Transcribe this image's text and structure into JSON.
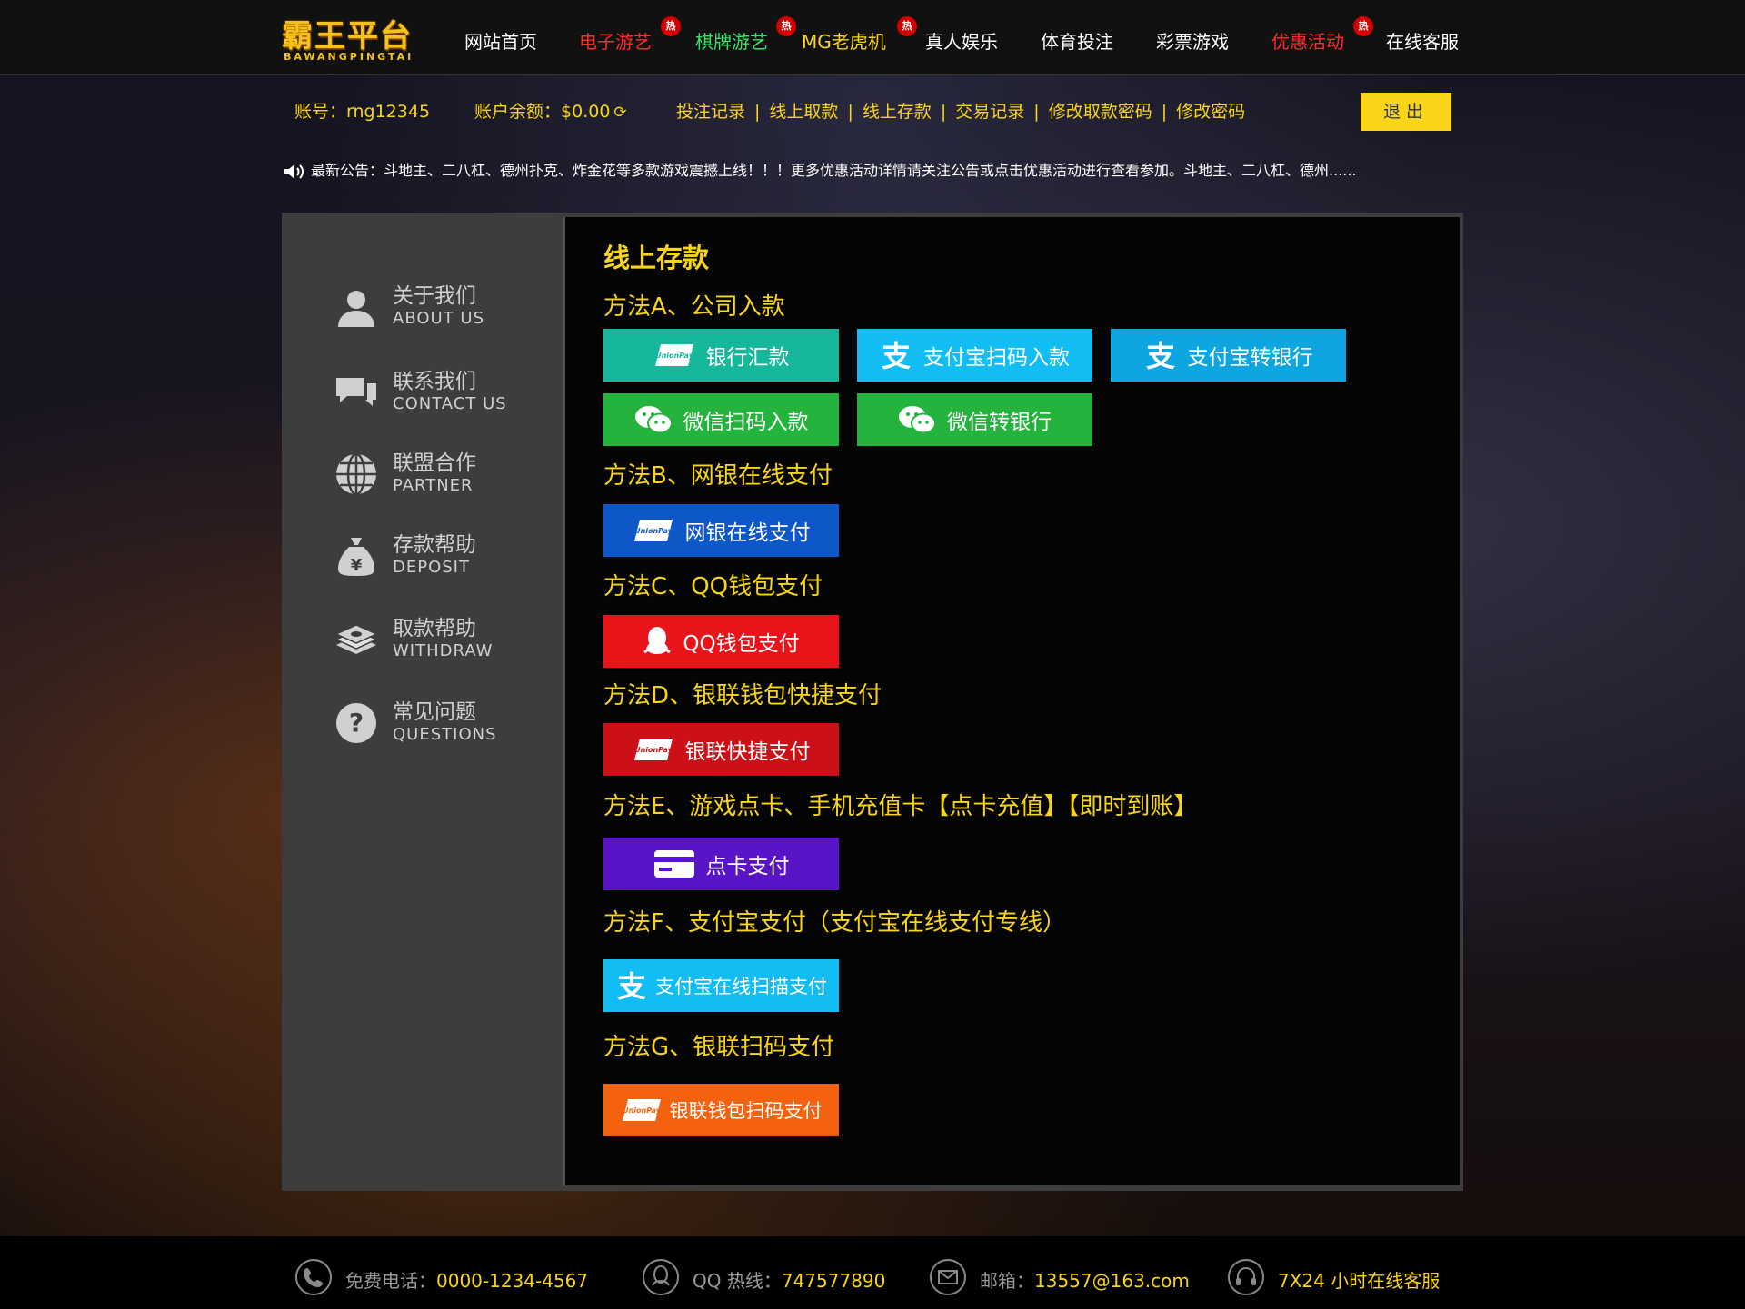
{
  "header": {
    "logo": {
      "main": "霸王平台",
      "sub": "BAWANGPINGTAI"
    },
    "nav": [
      {
        "label": "网站首页",
        "color": "white",
        "hot": false
      },
      {
        "label": "电子游艺",
        "color": "red",
        "hot": true
      },
      {
        "label": "棋牌游艺",
        "color": "green",
        "hot": true
      },
      {
        "label": "MG老虎机",
        "color": "yellow",
        "hot": true
      },
      {
        "label": "真人娱乐",
        "color": "white",
        "hot": false
      },
      {
        "label": "体育投注",
        "color": "white",
        "hot": false
      },
      {
        "label": "彩票游戏",
        "color": "white",
        "hot": false
      },
      {
        "label": "优惠活动",
        "color": "red",
        "hot": true
      },
      {
        "label": "在线客服",
        "color": "white",
        "hot": false
      }
    ],
    "hot_badge": "热"
  },
  "account": {
    "account_label": "账号：",
    "account_value": "rng12345",
    "balance_label": "账户余额：",
    "balance_value": "$0.00",
    "links": [
      "投注记录",
      "线上取款",
      "线上存款",
      "交易记录",
      "修改取款密码",
      "修改密码"
    ],
    "separator": "|",
    "logout": "退出"
  },
  "notice": "最新公告：斗地主、二八杠、德州扑克、炸金花等多款游戏震撼上线！！！更多优惠活动详情请关注公告或点击优惠活动进行查看参加。斗地主、二八杠、德州......",
  "sidebar": [
    {
      "cn": "关于我们",
      "en": "ABOUT US",
      "icon": "user-icon"
    },
    {
      "cn": "联系我们",
      "en": "CONTACT US",
      "icon": "chat-icon"
    },
    {
      "cn": "联盟合作",
      "en": "PARTNER",
      "icon": "globe-icon"
    },
    {
      "cn": "存款帮助",
      "en": "DEPOSIT",
      "icon": "money-bag-icon"
    },
    {
      "cn": "取款帮助",
      "en": "WITHDRAW",
      "icon": "cash-stack-icon"
    },
    {
      "cn": "常见问题",
      "en": "QUESTIONS",
      "icon": "question-icon"
    }
  ],
  "content": {
    "title": "线上存款",
    "methods": [
      {
        "label": "方法A、公司入款",
        "buttons": [
          {
            "label": "银行汇款",
            "color": "#17b79c",
            "icon": "unionpay-icon"
          },
          {
            "label": "支付宝扫码入款",
            "color": "#12bdf4",
            "icon": "alipay-icon"
          },
          {
            "label": "支付宝转银行",
            "color": "#0ea6e0",
            "icon": "alipay-icon"
          },
          {
            "label": "微信扫码入款",
            "color": "#24b33d",
            "icon": "wechat-icon"
          },
          {
            "label": "微信转银行",
            "color": "#24b33d",
            "icon": "wechat-icon"
          }
        ]
      },
      {
        "label": "方法B、网银在线支付",
        "buttons": [
          {
            "label": "网银在线支付",
            "color": "#0d57c9",
            "icon": "unionpay-icon"
          }
        ]
      },
      {
        "label": "方法C、QQ钱包支付",
        "buttons": [
          {
            "label": "QQ钱包支付",
            "color": "#e8141a",
            "icon": "qq-icon"
          }
        ]
      },
      {
        "label": "方法D、银联钱包快捷支付",
        "buttons": [
          {
            "label": "银联快捷支付",
            "color": "#cc1017",
            "icon": "unionpay-icon"
          }
        ]
      },
      {
        "label": "方法E、游戏点卡、手机充值卡【点卡充值】【即时到账】",
        "buttons": [
          {
            "label": "点卡支付",
            "color": "#5a14c8",
            "icon": "card-icon"
          }
        ]
      },
      {
        "label": "方法F、支付宝支付（支付宝在线支付专线）",
        "buttons": [
          {
            "label": "支付宝在线扫描支付",
            "color": "#12bdf4",
            "icon": "alipay-icon"
          }
        ]
      },
      {
        "label": "方法G、银联扫码支付",
        "buttons": [
          {
            "label": "银联钱包扫码支付",
            "color": "#f5620f",
            "icon": "unionpay-icon"
          }
        ]
      }
    ]
  },
  "footer": [
    {
      "label": "免费电话：",
      "value": "0000-1234-4567",
      "icon": "phone-icon"
    },
    {
      "label": "QQ 热线：",
      "value": "747577890",
      "icon": "qq-icon"
    },
    {
      "label": "邮箱：",
      "value": "13557@163.com",
      "icon": "mail-icon"
    },
    {
      "label": "",
      "value": "7X24 小时在线客服",
      "icon": "headset-icon"
    }
  ]
}
